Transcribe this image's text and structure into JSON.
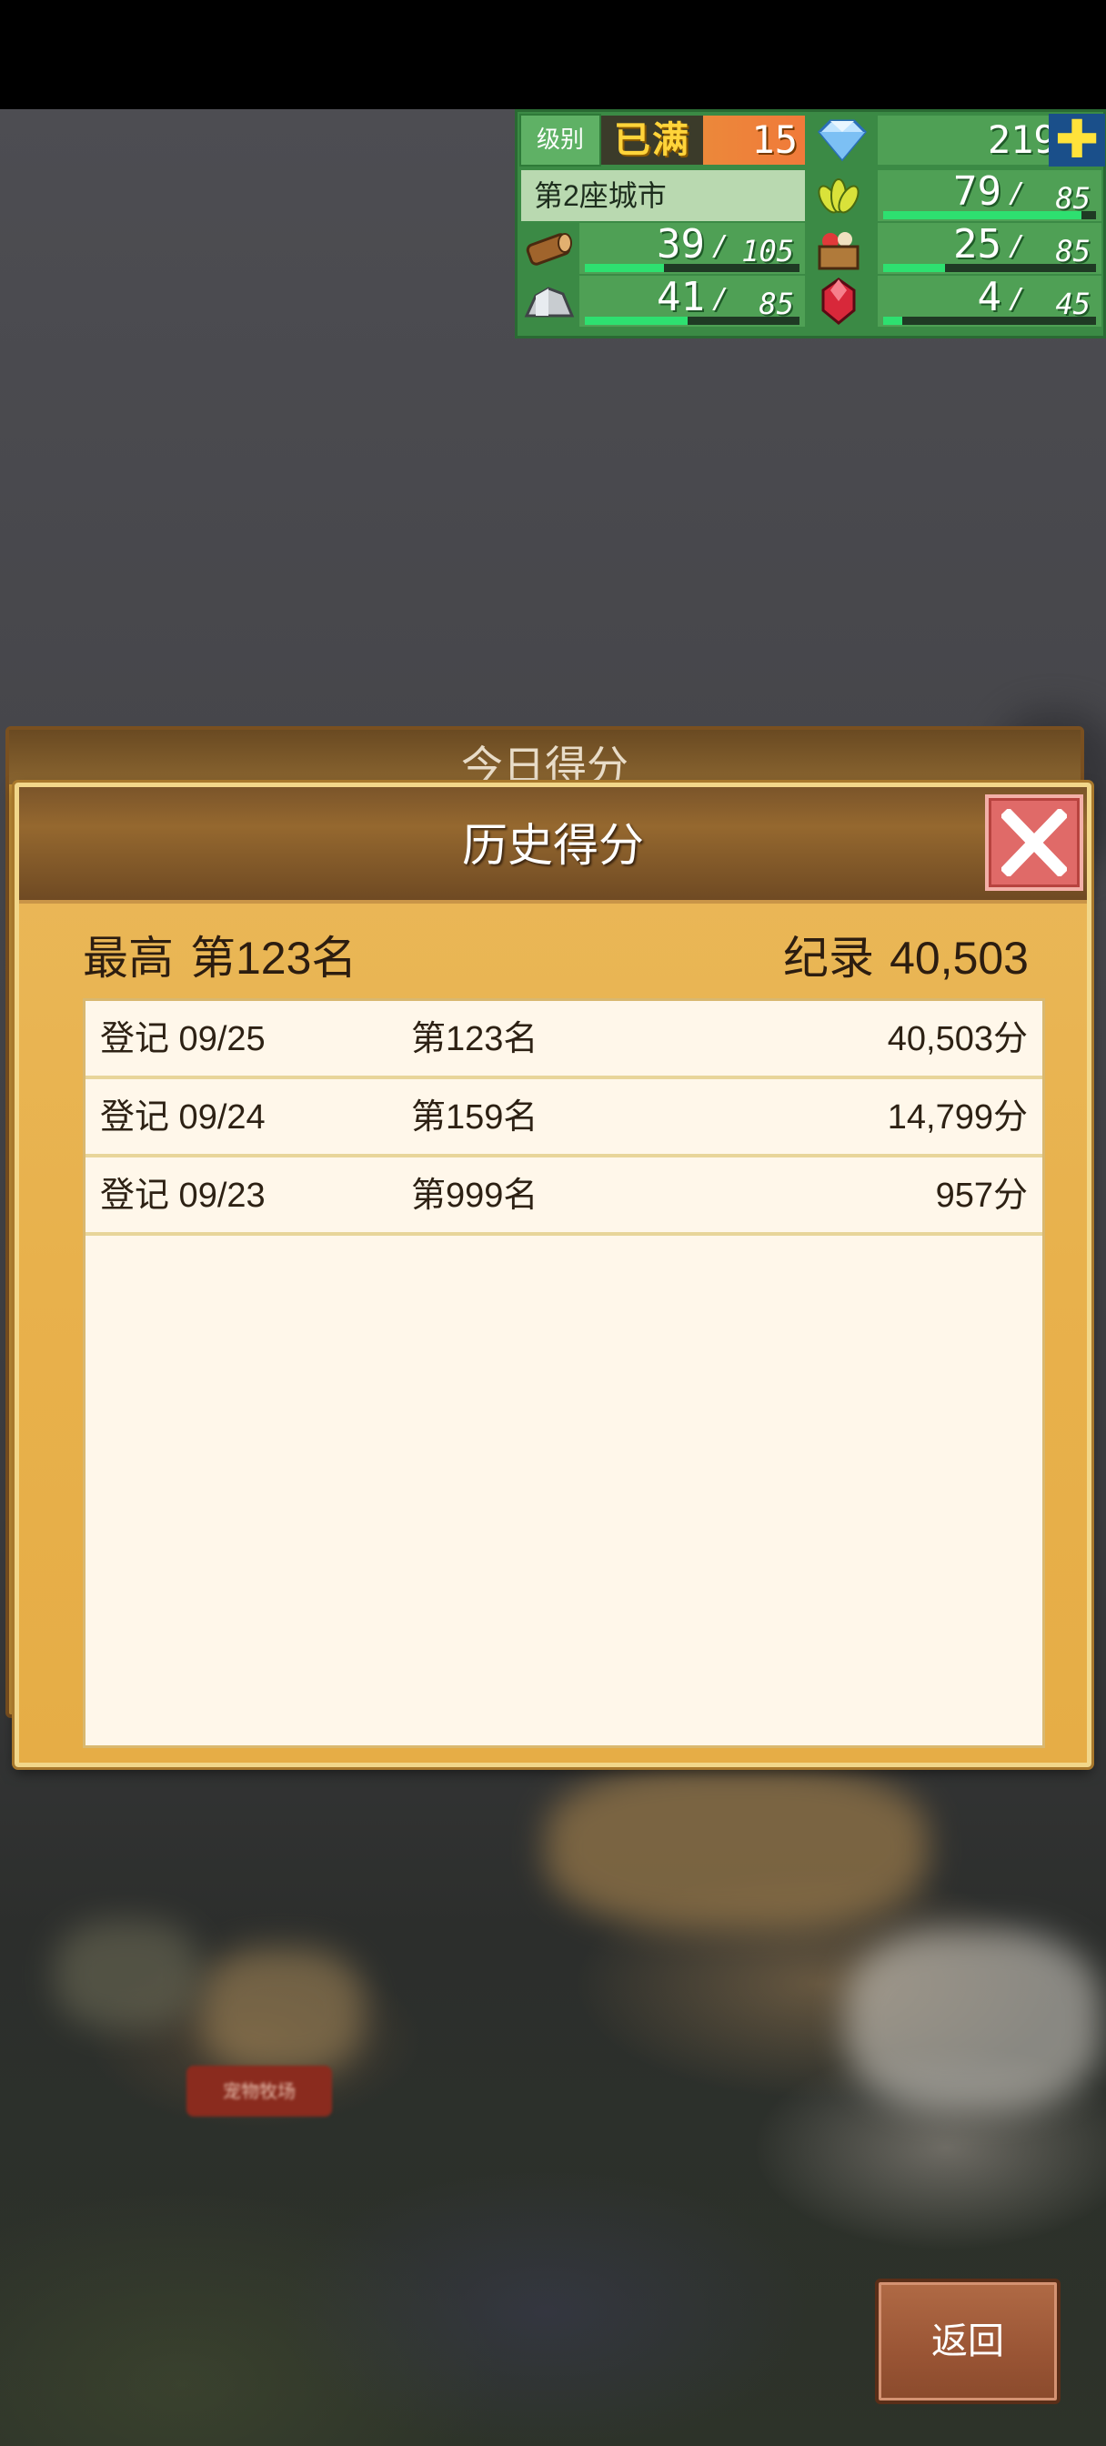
{
  "hud": {
    "level_label": "级别",
    "level_status": "已满",
    "level_number": "15",
    "gems": "2198",
    "plus_symbol": "✚",
    "city_name": "第2座城市",
    "resources": [
      {
        "icon": "wheat-icon",
        "current": "79",
        "max": "85",
        "fill": 0.93
      },
      {
        "icon": "wood-icon",
        "current": "39",
        "max": "105",
        "fill": 0.37
      },
      {
        "icon": "food-basket-icon",
        "current": "25",
        "max": "85",
        "fill": 0.29
      },
      {
        "icon": "ore-icon",
        "current": "41",
        "max": "85",
        "fill": 0.48
      },
      {
        "icon": "ruby-icon",
        "current": "4",
        "max": "45",
        "fill": 0.09
      }
    ]
  },
  "background_panel": {
    "title": "今日得分"
  },
  "map": {
    "label": "宠物牧场"
  },
  "dialog": {
    "title": "历史得分",
    "best_label": "最高",
    "best_rank": "第123名",
    "record_label": "纪录",
    "record_value": "40,503",
    "rows": [
      {
        "date": "登记 09/25",
        "rank": "第123名",
        "score": "40,503分"
      },
      {
        "date": "登记 09/24",
        "rank": "第159名",
        "score": "14,799分"
      },
      {
        "date": "登记 09/23",
        "rank": "第999名",
        "score": "957分"
      }
    ]
  },
  "footer": {
    "back_label": "返回"
  },
  "colors": {
    "panel": "#e8b14c",
    "header": "#7b552a",
    "hud": "#3b8a45",
    "close": "#e06a68"
  }
}
